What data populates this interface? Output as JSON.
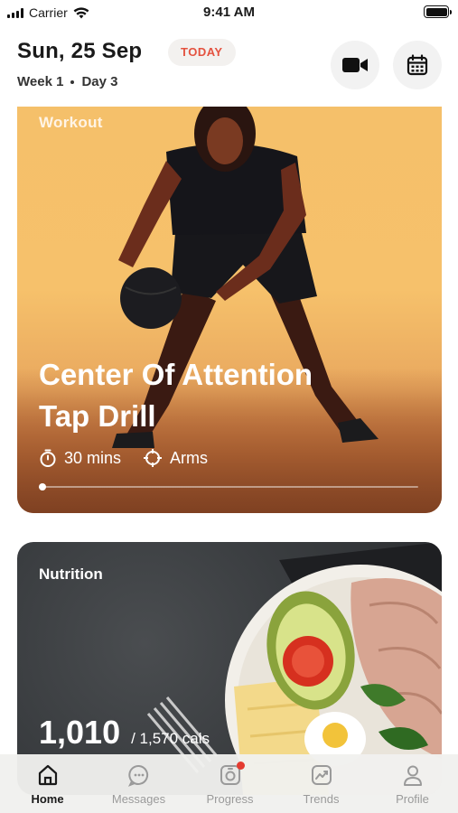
{
  "status_bar": {
    "carrier": "Carrier",
    "time": "9:41 AM"
  },
  "header": {
    "date": "Sun, 25 Sep",
    "today_badge": "TODAY",
    "week": "Week 1",
    "day": "Day 3"
  },
  "workout": {
    "label": "Workout",
    "title_line1": "Center Of Attention",
    "title_line2": "Tap Drill",
    "duration": "30 mins",
    "focus": "Arms",
    "progress_percent": 1
  },
  "nutrition": {
    "label": "Nutrition",
    "calories": "1,010",
    "calories_goal": "/ 1,570 cals"
  },
  "tabs": [
    {
      "label": "Home",
      "icon": "home-icon",
      "active": true
    },
    {
      "label": "Messages",
      "icon": "messages-icon",
      "active": false
    },
    {
      "label": "Progress",
      "icon": "progress-icon",
      "active": false,
      "badge": true
    },
    {
      "label": "Trends",
      "icon": "trends-icon",
      "active": false
    },
    {
      "label": "Profile",
      "icon": "profile-icon",
      "active": false
    }
  ],
  "colors": {
    "accent": "#e4523f",
    "badge": "#e43b30",
    "workout_bg": "#f5c06a",
    "nutrition_bg": "#3a3d40"
  }
}
